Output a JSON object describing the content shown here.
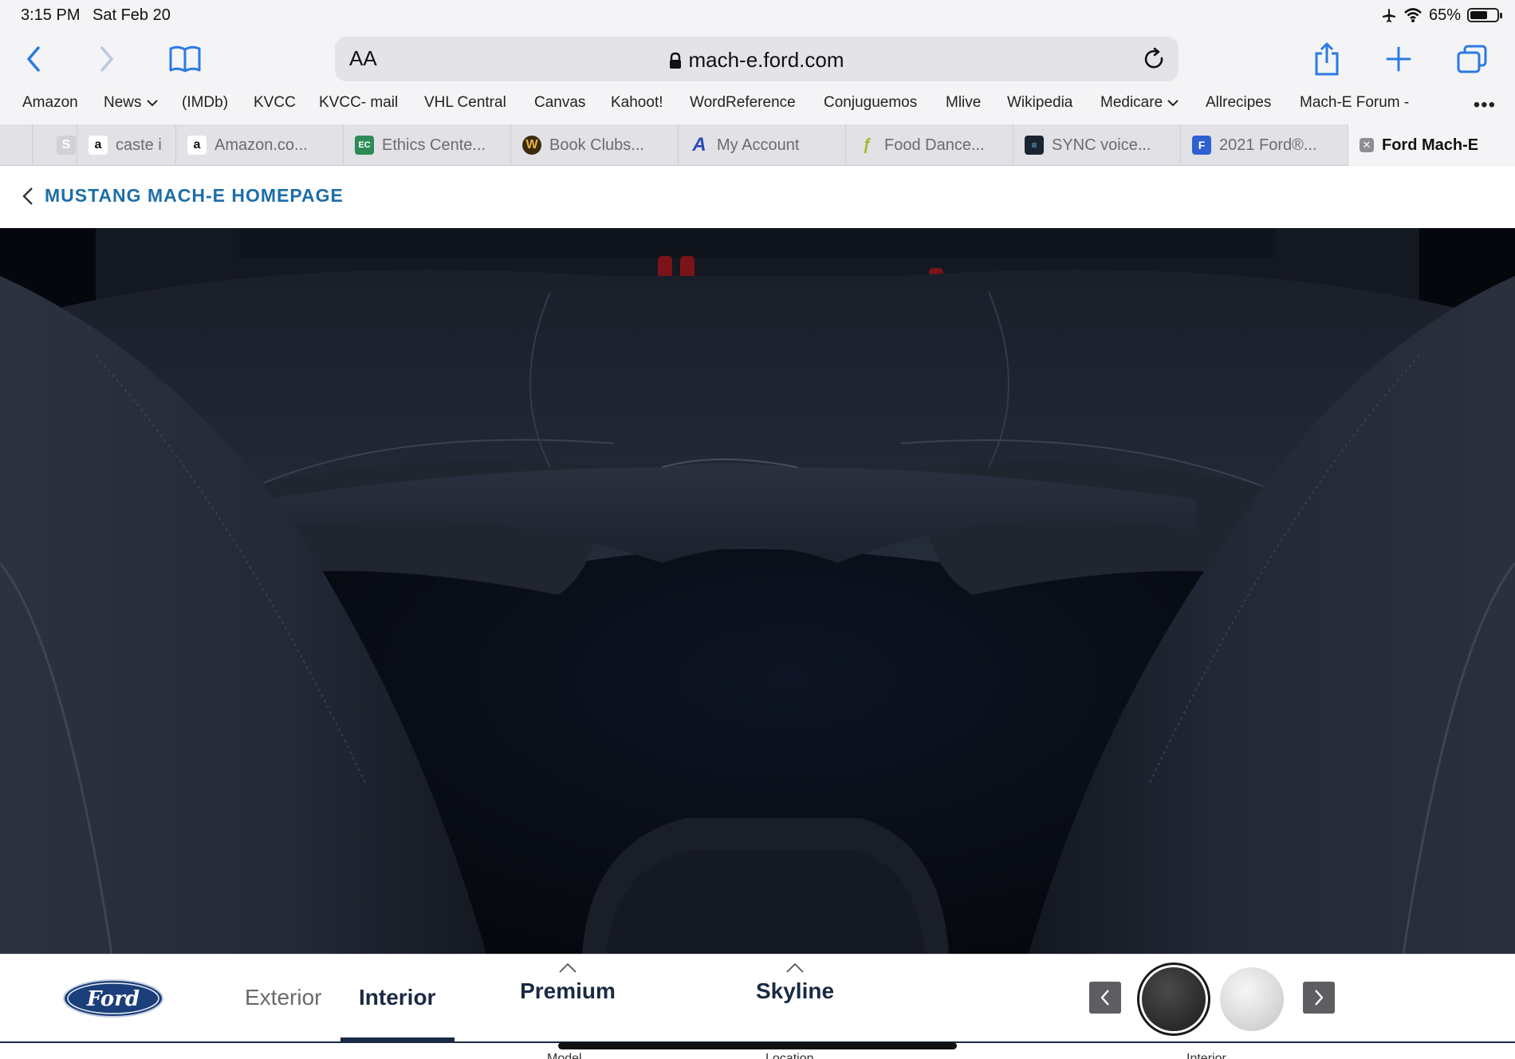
{
  "status_bar": {
    "time": "3:15 PM",
    "date": "Sat Feb 20",
    "battery": "65%",
    "battery_level": 0.65
  },
  "toolbar": {
    "text_size_label": "AA",
    "url": "mach-e.ford.com"
  },
  "favorites": [
    "Amazon",
    "News",
    "(IMDb)",
    "KVCC",
    "KVCC- mail",
    "VHL Central",
    "Canvas",
    "Kahoot!",
    "WordReference",
    "Conjuguemos",
    "Mlive",
    "Wikipedia",
    "Medicare",
    "Allrecipes",
    "Mach-E Forum -"
  ],
  "tabs": [
    {
      "title": "caste i",
      "icon": "amazon-icon"
    },
    {
      "title": "Amazon.co...",
      "icon": "amazon-icon"
    },
    {
      "title": "Ethics Cente...",
      "icon": "ethics-center-icon"
    },
    {
      "title": "Book Clubs...",
      "icon": "book-clubs-icon"
    },
    {
      "title": "My Account",
      "icon": "my-account-icon"
    },
    {
      "title": "Food Dance...",
      "icon": "food-dance-icon"
    },
    {
      "title": "SYNC voice...",
      "icon": "sync-voice-icon"
    },
    {
      "title": "2021 Ford®...",
      "icon": "ford-2021-icon"
    },
    {
      "title": "Ford Mach-E",
      "icon": "close-icon"
    }
  ],
  "page": {
    "back_label": "MUSTANG MACH-E HOMEPAGE"
  },
  "configurator": {
    "logo_text": "Ford",
    "view_tabs": [
      "Exterior",
      "Interior"
    ],
    "active_view": "Interior",
    "trim": "Premium",
    "package": "Skyline",
    "sub_labels": [
      "Model",
      "Location",
      "Interior"
    ],
    "swatches": [
      {
        "name": "black-swatch",
        "color": "#3a3a3a",
        "selected": true
      },
      {
        "name": "white-swatch",
        "color": "#e6e6e6",
        "selected": false
      }
    ]
  },
  "colors": {
    "link_blue": "#1d6ea8",
    "navy": "#1a2a44"
  }
}
